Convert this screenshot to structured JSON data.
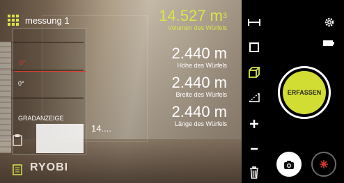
{
  "header": {
    "title": "messung 1",
    "menu_icon": "grid-menu-icon"
  },
  "volume": {
    "value": "14.527 m",
    "unit_sup": "3",
    "label": "Volumen des Würfels",
    "accent_color": "#d9e54a"
  },
  "measurements": [
    {
      "value": "2.440 m",
      "label": "Höhe des Würfels"
    },
    {
      "value": "2.440 m",
      "label": "Breite des Würfels"
    },
    {
      "value": "2.440 m",
      "label": "Länge des Würfels"
    }
  ],
  "gradient_panel": {
    "title": "GRADANZEIGE",
    "upper_reading": "0°",
    "lower_reading": "0°",
    "indicator_color": "#e03a2c"
  },
  "secondary_value": "14....",
  "brand": "RYOBI",
  "toolbar": {
    "items": [
      {
        "name": "line-measure-icon"
      },
      {
        "name": "square-area-icon"
      },
      {
        "name": "cube-volume-icon",
        "active": true
      },
      {
        "name": "angle-icon"
      },
      {
        "name": "plus-icon"
      },
      {
        "name": "minus-icon"
      },
      {
        "name": "trash-icon"
      }
    ]
  },
  "side_panel": {
    "settings_icon": "gear-icon",
    "battery_icon": "battery-icon",
    "capture_label": "ERFASSEN",
    "capture_color": "#d1dd33",
    "camera_icon": "camera-icon",
    "laser_icon": "laser-icon"
  }
}
